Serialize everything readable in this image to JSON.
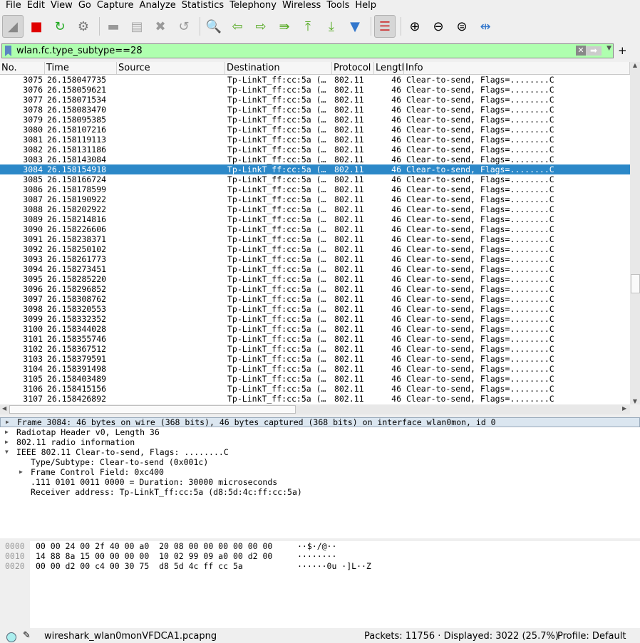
{
  "menu": [
    "File",
    "Edit",
    "View",
    "Go",
    "Capture",
    "Analyze",
    "Statistics",
    "Telephony",
    "Wireless",
    "Tools",
    "Help"
  ],
  "toolbar": [
    {
      "icon": "shark-fin-start-icon",
      "glyph": "◢",
      "color": "#888",
      "on": true
    },
    {
      "icon": "stop-capture-icon",
      "glyph": "■",
      "color": "#e00000"
    },
    {
      "icon": "restart-capture-icon",
      "glyph": "↻",
      "color": "#2a2"
    },
    {
      "icon": "capture-options-gear-icon",
      "glyph": "⚙",
      "color": "#777"
    },
    {
      "sep": true
    },
    {
      "icon": "open-file-folder-icon",
      "glyph": "▬",
      "color": "#999"
    },
    {
      "icon": "save-file-icon",
      "glyph": "▤",
      "color": "#aaa"
    },
    {
      "icon": "close-file-icon",
      "glyph": "✖",
      "color": "#999"
    },
    {
      "icon": "reload-file-icon",
      "glyph": "↺",
      "color": "#999"
    },
    {
      "sep": true
    },
    {
      "icon": "find-packet-magnifier-icon",
      "glyph": "🔍",
      "color": "#000"
    },
    {
      "icon": "go-back-arrow-icon",
      "glyph": "⇦",
      "color": "#5a2"
    },
    {
      "icon": "go-forward-arrow-icon",
      "glyph": "⇨",
      "color": "#5a2"
    },
    {
      "icon": "go-to-packet-icon",
      "glyph": "⇛",
      "color": "#5a2"
    },
    {
      "icon": "first-packet-icon",
      "glyph": "⤒",
      "color": "#5a2"
    },
    {
      "icon": "last-packet-icon",
      "glyph": "⤓",
      "color": "#5a2"
    },
    {
      "icon": "autoscroll-icon",
      "glyph": "▼",
      "color": "#37c"
    },
    {
      "sep": true
    },
    {
      "icon": "colorize-packet-list-icon",
      "glyph": "☰",
      "color": "#c33",
      "on": true
    },
    {
      "sep": true
    },
    {
      "icon": "zoom-in-icon",
      "glyph": "⊕",
      "color": "#000"
    },
    {
      "icon": "zoom-out-icon",
      "glyph": "⊖",
      "color": "#000"
    },
    {
      "icon": "zoom-normal-icon",
      "glyph": "⊜",
      "color": "#000"
    },
    {
      "icon": "resize-columns-icon",
      "glyph": "⇹",
      "color": "#37c"
    }
  ],
  "filter": {
    "value": "wlan.fc.type_subtype==28",
    "add_label": "+"
  },
  "columns": [
    "No.",
    "Time",
    "Source",
    "Destination",
    "Protocol",
    "Length",
    "Info"
  ],
  "selected_no": "3084",
  "packets": [
    [
      "3075",
      "26.158047735"
    ],
    [
      "3076",
      "26.158059621"
    ],
    [
      "3077",
      "26.158071534"
    ],
    [
      "3078",
      "26.158083470"
    ],
    [
      "3079",
      "26.158095385"
    ],
    [
      "3080",
      "26.158107216"
    ],
    [
      "3081",
      "26.158119113"
    ],
    [
      "3082",
      "26.158131186"
    ],
    [
      "3083",
      "26.158143084"
    ],
    [
      "3084",
      "26.158154918"
    ],
    [
      "3085",
      "26.158166724"
    ],
    [
      "3086",
      "26.158178599"
    ],
    [
      "3087",
      "26.158190922"
    ],
    [
      "3088",
      "26.158202922"
    ],
    [
      "3089",
      "26.158214816"
    ],
    [
      "3090",
      "26.158226606"
    ],
    [
      "3091",
      "26.158238371"
    ],
    [
      "3092",
      "26.158250102"
    ],
    [
      "3093",
      "26.158261773"
    ],
    [
      "3094",
      "26.158273451"
    ],
    [
      "3095",
      "26.158285220"
    ],
    [
      "3096",
      "26.158296852"
    ],
    [
      "3097",
      "26.158308762"
    ],
    [
      "3098",
      "26.158320553"
    ],
    [
      "3099",
      "26.158332352"
    ],
    [
      "3100",
      "26.158344028"
    ],
    [
      "3101",
      "26.158355746"
    ],
    [
      "3102",
      "26.158367512"
    ],
    [
      "3103",
      "26.158379591"
    ],
    [
      "3104",
      "26.158391498"
    ],
    [
      "3105",
      "26.158403489"
    ],
    [
      "3106",
      "26.158415156"
    ],
    [
      "3107",
      "26.158426892"
    ]
  ],
  "packet_common": {
    "source": "",
    "destination": "Tp-LinkT_ff:cc:5a (…",
    "protocol": "802.11",
    "length": "46",
    "info": "Clear-to-send, Flags=........C"
  },
  "details": [
    {
      "text": "Frame 3084: 46 bytes on wire (368 bits), 46 bytes captured (368 bits) on interface wlan0mon, id 0",
      "indent": 0,
      "arrow": "right",
      "selected": true
    },
    {
      "text": "Radiotap Header v0, Length 36",
      "indent": 0,
      "arrow": "right"
    },
    {
      "text": "802.11 radio information",
      "indent": 0,
      "arrow": "right"
    },
    {
      "text": "IEEE 802.11 Clear-to-send, Flags: ........C",
      "indent": 0,
      "arrow": "down"
    },
    {
      "text": "Type/Subtype: Clear-to-send (0x001c)",
      "indent": 1,
      "arrow": ""
    },
    {
      "text": "Frame Control Field: 0xc400",
      "indent": 1,
      "arrow": "right"
    },
    {
      "text": ".111 0101 0011 0000 = Duration: 30000 microseconds",
      "indent": 1,
      "arrow": ""
    },
    {
      "text": "Receiver address: Tp-LinkT_ff:cc:5a (d8:5d:4c:ff:cc:5a)",
      "indent": 1,
      "arrow": ""
    }
  ],
  "bytes": [
    {
      "offset": "0000",
      "hex": "00 00 24 00 2f 40 00 a0  20 08 00 00 00 00 00 00",
      "ascii": "··$·/@··"
    },
    {
      "offset": "0010",
      "hex": "14 88 8a 15 00 00 00 00  10 02 99 09 a0 00 d2 00",
      "ascii": "········"
    },
    {
      "offset": "0020",
      "hex": "00 00 d2 00 c4 00 30 75  d8 5d 4c ff cc 5a",
      "ascii": "······0u ·]L··Z"
    }
  ],
  "status": {
    "file": "wireshark_wlan0monVFDCA1.pcapng",
    "packets": "Packets: 11756 · Displayed: 3022 (25.7%)",
    "profile": "Profile: Default"
  }
}
